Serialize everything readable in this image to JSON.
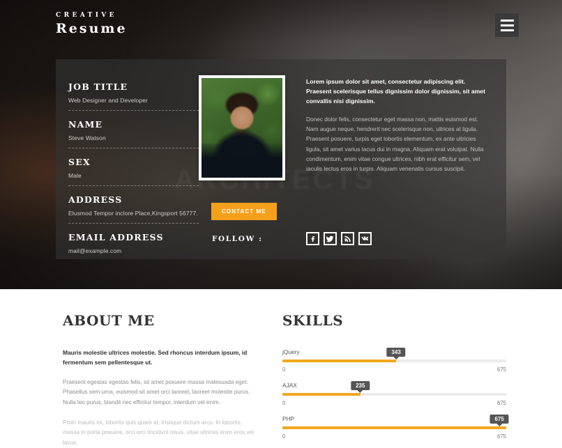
{
  "header": {
    "brand_sub": "Creative",
    "brand_main": "Resume",
    "menu_icon": "hamburger-menu-icon"
  },
  "hero": {
    "background_letters": "ARCHITECTS",
    "card": {
      "info_fields": [
        {
          "label": "JOB TITLE",
          "value": "Web Designer and Developer"
        },
        {
          "label": "NAME",
          "value": "Steve Watson"
        },
        {
          "label": "SEX",
          "value": "Male"
        },
        {
          "label": "ADDRESS",
          "value": "Elusmod Tempor inclore Place,Kingsport 56777."
        },
        {
          "label": "EMAIL ADDRESS",
          "value": "mail@example.com"
        }
      ],
      "photo_alt": "profile-portrait",
      "lead_text": "Lorem ipsum dolor sit amet, consectetur adipiscing elit. Praesent scelerisque tellus dignissim dolor dignissim, sit amet convallis nisi dignissim.",
      "body_text": "Donec dolor felis, consectetur eget massa non, mattis euismod est. Nam augue neque, hendrerit nec scelerisque non, ultrices at ligula. Praesent posuere, turpis eget lobortis elementum, ex ante ultricies ligula, sit amet varius lacus dui in magna. Aliquam erat volutpat. Nulla condimentum, enim vitae congue ultrices, nibh erat efficitur sem, vel iaculis lectus eros in turpis. Aliquam venenatis cursus suscipit.",
      "contact_button": "CONTACT ME",
      "follow_label": "FOLLOW :",
      "social_links": [
        {
          "name": "facebook-icon",
          "glyph": "f"
        },
        {
          "name": "twitter-icon",
          "glyph": "twitter"
        },
        {
          "name": "rss-icon",
          "glyph": "rss"
        },
        {
          "name": "vk-icon",
          "glyph": "vk"
        }
      ]
    }
  },
  "about": {
    "title": "ABOUT ME",
    "lead": "Mauris molestie ultrices molestie. Sed rhoncus interdum ipsum, id fermentum sem pellentesque ut.",
    "paragraph_1": "Praesent egestas egestas felis, sit amet posuere massa malesuada eget. Phasellus sem urna, euismod sit amet orci laoreet, laoreet molestie purus. Nulla leo purus, blandit nec efficitur tempor, interdum vel enim.",
    "paragraph_2": "Proin mauris mi, lobortis quis quam at, tristique dictum arcu. In lobortis, massa in porta posuere, orci orci tincidunt nisus, vitae ultrices enim eros vel lacus."
  },
  "skills": {
    "title": "SKILLS"
  },
  "chart_data": {
    "type": "bar",
    "title": "SKILLS",
    "orientation": "horizontal",
    "categories": [
      "jQuery",
      "AJAX",
      "PHP"
    ],
    "values": [
      343,
      235,
      675
    ],
    "xlim": [
      0,
      675
    ],
    "axis_min_label": "0",
    "axis_max_label": "675",
    "value_labels": [
      "343",
      "235",
      "675"
    ],
    "bar_color": "#f0a81e",
    "track_color": "#ebebeb",
    "tooltip_color": "#555555",
    "grid": false,
    "legend": false
  },
  "colors": {
    "accent": "#f5a01b",
    "bar": "#f0a81e",
    "card_overlay": "#343332",
    "heading": "#333333",
    "muted_text": "#8d8d8d"
  }
}
